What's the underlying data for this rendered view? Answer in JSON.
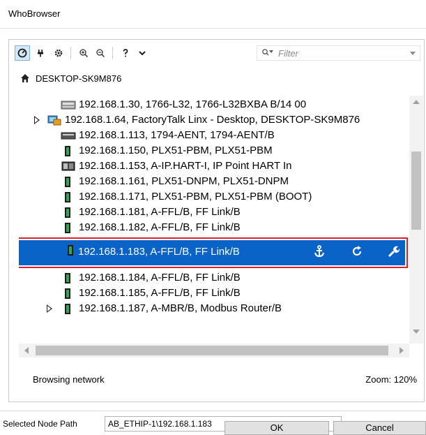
{
  "window": {
    "title": "WhoBrowser"
  },
  "toolbar": {
    "buttons": [
      {
        "name": "browse-mode-icon",
        "active": true
      },
      {
        "name": "plug-icon"
      },
      {
        "name": "gear-icon"
      },
      {
        "name": "zoom-in-icon"
      },
      {
        "name": "zoom-out-icon"
      },
      {
        "name": "help-icon"
      },
      {
        "name": "chevron-down-icon"
      }
    ],
    "filter_placeholder": "Filter"
  },
  "root": {
    "label": "DESKTOP-SK9M876"
  },
  "tree": {
    "rows": [
      {
        "label": "192.168.1.30, 1766-L32, 1766-L32BXBA B/14 00",
        "icon": "plc-icon",
        "expandable": false
      },
      {
        "label": "192.168.1.64, FactoryTalk Linx - Desktop, DESKTOP-SK9M876",
        "icon": "workstation-icon",
        "expandable": true
      },
      {
        "label": "192.168.1.113, 1794-AENT, 1794-AENT/B",
        "icon": "adapter-icon",
        "expandable": false
      },
      {
        "label": "192.168.1.150, PLX51-PBM, PLX51-PBM",
        "icon": "module-icon",
        "expandable": false
      },
      {
        "label": "192.168.1.153, A-IP.HART-I, IP Point HART In",
        "icon": "io-module-icon",
        "expandable": false
      },
      {
        "label": "192.168.1.161, PLX51-DNPM, PLX51-DNPM",
        "icon": "module-icon",
        "expandable": false
      },
      {
        "label": "192.168.1.171, PLX51-PBM, PLX51-PBM (BOOT)",
        "icon": "module-icon",
        "expandable": false
      },
      {
        "label": "192.168.1.181, A-FFL/B, FF Link/B",
        "icon": "module-icon",
        "expandable": false
      },
      {
        "label": "192.168.1.182, A-FFL/B, FF Link/B",
        "icon": "module-icon",
        "expandable": false
      },
      {
        "label": "192.168.1.183, A-FFL/B, FF Link/B",
        "icon": "module-icon",
        "expandable": false,
        "selected": true
      },
      {
        "label": "192.168.1.184, A-FFL/B, FF Link/B",
        "icon": "module-icon",
        "expandable": false
      },
      {
        "label": "192.168.1.185, A-FFL/B, FF Link/B",
        "icon": "module-icon",
        "expandable": false
      },
      {
        "label": "192.168.1.187, A-MBR/B, Modbus Router/B",
        "icon": "module-icon",
        "expandable": true
      }
    ],
    "selected_actions": [
      "anchor-icon",
      "refresh-icon",
      "wrench-icon"
    ]
  },
  "status": {
    "message": "Browsing network",
    "zoom": "Zoom: 120%"
  },
  "path": {
    "label": "Selected Node Path",
    "value": "AB_ETHIP-1\\192.168.1.183"
  },
  "buttons": {
    "ok": "OK",
    "cancel": "Cancel"
  },
  "colors": {
    "selection": "#0a64c8",
    "highlight_border": "#d9222a"
  }
}
